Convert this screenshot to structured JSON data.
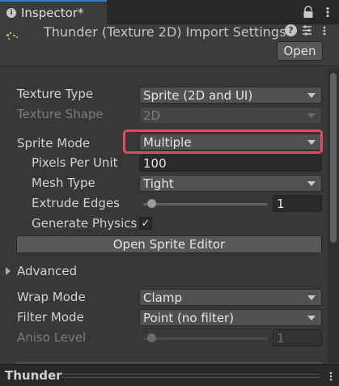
{
  "tab": {
    "title": "Inspector*"
  },
  "header": {
    "title": "Thunder (Texture 2D) Import Settings",
    "open_label": "Open"
  },
  "fields": {
    "texture_type": {
      "label": "Texture Type",
      "value": "Sprite (2D and UI)"
    },
    "texture_shape": {
      "label": "Texture Shape",
      "value": "2D"
    },
    "sprite_mode": {
      "label": "Sprite Mode",
      "value": "Multiple"
    },
    "pixels_per_unit": {
      "label": "Pixels Per Unit",
      "value": "100"
    },
    "mesh_type": {
      "label": "Mesh Type",
      "value": "Tight"
    },
    "extrude_edges": {
      "label": "Extrude Edges",
      "value": "1",
      "slider_fraction": 0.0625
    },
    "generate_physics": {
      "label": "Generate Physics",
      "checked": true,
      "check_glyph": "✓"
    },
    "wrap_mode": {
      "label": "Wrap Mode",
      "value": "Clamp"
    },
    "filter_mode": {
      "label": "Filter Mode",
      "value": "Point (no filter)"
    },
    "aniso_level": {
      "label": "Aniso Level",
      "value": "1",
      "slider_fraction": 0.0625
    }
  },
  "open_sprite_editor_label": "Open Sprite Editor",
  "advanced_label": "Advanced",
  "footer": {
    "title": "Thunder"
  },
  "colors": {
    "accent_tab": "#3a79bb",
    "highlight": "#e34a5c",
    "background": "#383838"
  },
  "icons": [
    "info-icon",
    "lock-icon",
    "menu-icon",
    "texture-thumbnail-icon",
    "help-icon",
    "preset-icon",
    "foldout-arrow-icon",
    "dropdown-arrow-icon",
    "checkmark-icon"
  ]
}
